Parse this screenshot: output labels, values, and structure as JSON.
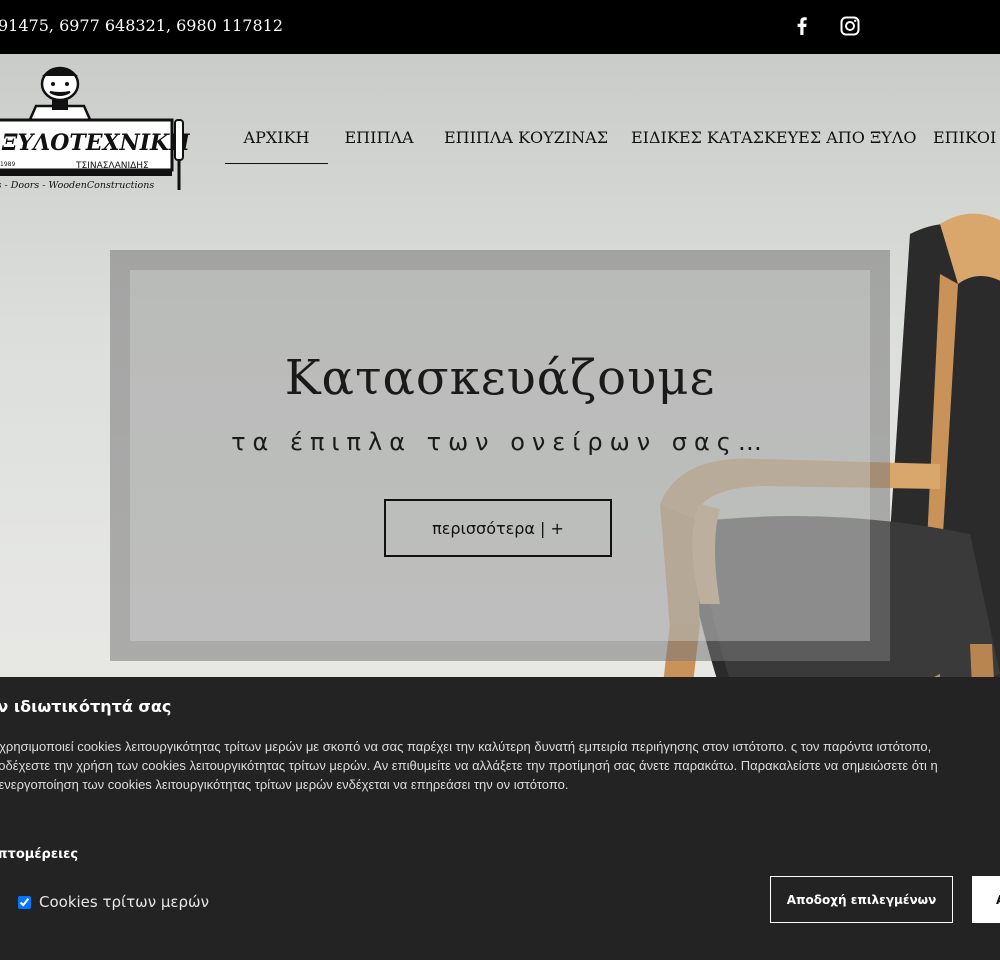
{
  "topbar": {
    "phones": "91475, 6977 648321, 6980 117812",
    "facebook_icon": "facebook-icon",
    "instagram_icon": "instagram-icon"
  },
  "logo": {
    "title": "ΞΥΛΟΤΕΧΝΙΚΗ",
    "subtitle": "ΤΣΙΝΑΣΛΑΝΙΔΗΣ",
    "year": "1989",
    "tagline": "mes - Doors - WoodenConstructions"
  },
  "nav": {
    "items": [
      {
        "label": "ΑΡΧΙΚΗ",
        "active": true
      },
      {
        "label": "ΕΠΙΠΛΑ"
      },
      {
        "label": "ΕΠΙΠΛΑ ΚΟΥΖΙΝΑΣ"
      },
      {
        "label": "ΕΙΔΙΚΕΣ ΚΑΤΑΣΚΕΥΕΣ ΑΠΟ ΞΥΛΟ"
      },
      {
        "label": "ΕΠΙΚΟΙ"
      }
    ]
  },
  "hero": {
    "title": "Κατασκευάζουμε",
    "subtitle": "τα έπιπλα των ονείρων σας…",
    "button": "περισσότερα | +"
  },
  "cookie": {
    "heading": "ην ιδιωτικότητά σας",
    "text": "ος χρησιμοποιεί cookies λειτουργικότητας τρίτων μερών με σκοπό να σας παρέχει την καλύτερη δυνατή εμπειρία περιήγησης στον ιστότοπο. ς τον παρόντα ιστότοπο, αποδέχεστε την χρήση των cookies λειτουργικότητας τρίτων μερών. Αν επιθυμείτε να αλλάξετε την προτίμησή σας άνετε παρακάτω. Παρακαλείστε να σημειώσετε ότι η απενεργοποίηση των cookies λειτουργικότητας τρίτων μερών ενδέχεται να επηρεάσει την ον ιστότοπο.",
    "details": "επτομέρειες",
    "checkbox_label": "Cookies τρίτων μερών",
    "accept_selected": "Αποδοχή επιλεγμένων",
    "accept_all": "Α"
  },
  "colors": {
    "topbar_bg": "#000000",
    "cookie_bg": "#232323",
    "frame": "#8a8a8a"
  }
}
